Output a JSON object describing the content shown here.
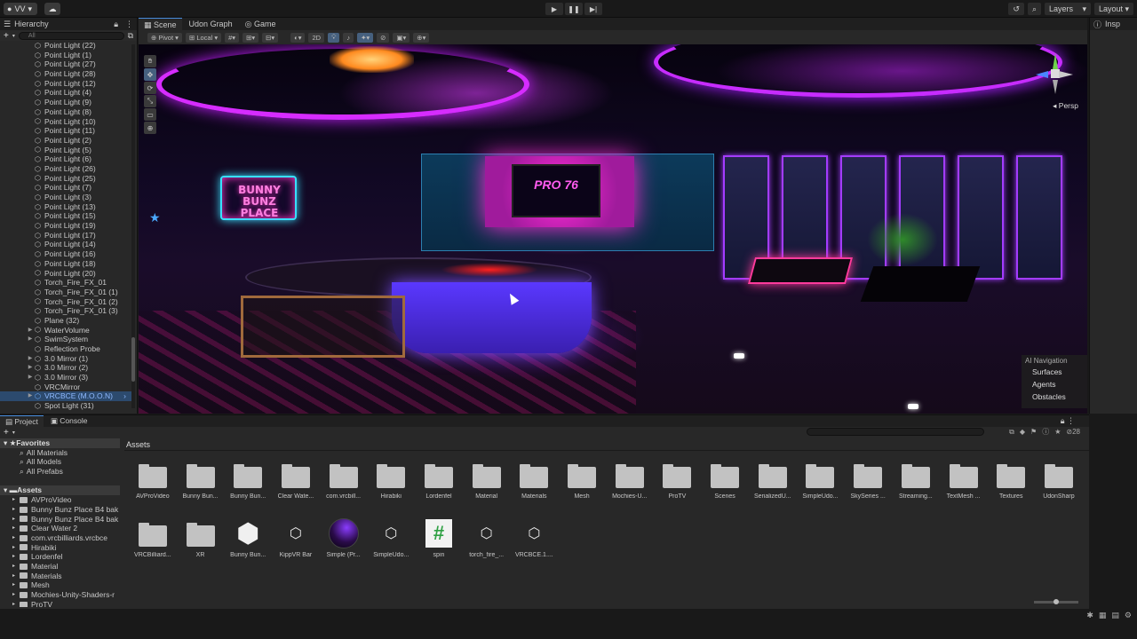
{
  "topbar": {
    "account_label": "VV",
    "right": {
      "layers_label": "Layers",
      "layout_label": "Layout"
    }
  },
  "hierarchy": {
    "tab_label": "Hierarchy",
    "search_placeholder": "All",
    "items": [
      {
        "label": "Point Light (22)",
        "kind": "obj"
      },
      {
        "label": "Point Light (1)",
        "kind": "obj"
      },
      {
        "label": "Point Light (27)",
        "kind": "obj"
      },
      {
        "label": "Point Light (28)",
        "kind": "obj"
      },
      {
        "label": "Point Light (12)",
        "kind": "obj"
      },
      {
        "label": "Point Light (4)",
        "kind": "obj"
      },
      {
        "label": "Point Light (9)",
        "kind": "obj"
      },
      {
        "label": "Point Light (8)",
        "kind": "obj"
      },
      {
        "label": "Point Light (10)",
        "kind": "obj"
      },
      {
        "label": "Point Light (11)",
        "kind": "obj"
      },
      {
        "label": "Point Light (2)",
        "kind": "obj"
      },
      {
        "label": "Point Light (5)",
        "kind": "obj"
      },
      {
        "label": "Point Light (6)",
        "kind": "obj"
      },
      {
        "label": "Point Light (26)",
        "kind": "obj"
      },
      {
        "label": "Point Light (25)",
        "kind": "obj"
      },
      {
        "label": "Point Light (7)",
        "kind": "obj"
      },
      {
        "label": "Point Light (3)",
        "kind": "obj"
      },
      {
        "label": "Point Light (13)",
        "kind": "obj"
      },
      {
        "label": "Point Light (15)",
        "kind": "obj"
      },
      {
        "label": "Point Light (19)",
        "kind": "obj"
      },
      {
        "label": "Point Light (17)",
        "kind": "obj"
      },
      {
        "label": "Point Light (14)",
        "kind": "obj"
      },
      {
        "label": "Point Light (16)",
        "kind": "obj"
      },
      {
        "label": "Point Light (18)",
        "kind": "obj"
      },
      {
        "label": "Point Light (20)",
        "kind": "obj"
      },
      {
        "label": "Torch_Fire_FX_01",
        "kind": "obj"
      },
      {
        "label": "Torch_Fire_FX_01 (1)",
        "kind": "obj"
      },
      {
        "label": "Torch_Fire_FX_01 (2)",
        "kind": "obj"
      },
      {
        "label": "Torch_Fire_FX_01 (3)",
        "kind": "obj"
      },
      {
        "label": "Plane (32)",
        "kind": "obj"
      },
      {
        "label": "WaterVolume",
        "kind": "group"
      },
      {
        "label": "SwimSystem",
        "kind": "group"
      },
      {
        "label": "Reflection Probe",
        "kind": "obj"
      },
      {
        "label": "3.0 Mirror (1)",
        "kind": "group"
      },
      {
        "label": "3.0 Mirror (2)",
        "kind": "group"
      },
      {
        "label": "3.0 Mirror (3)",
        "kind": "group"
      },
      {
        "label": "VRCMirror",
        "kind": "obj"
      },
      {
        "label": "VRCBCE (M.O.O.N)",
        "kind": "selected"
      },
      {
        "label": "Spot Light (31)",
        "kind": "obj"
      }
    ]
  },
  "scene": {
    "tabs": [
      "Scene",
      "Udon Graph",
      "Game"
    ],
    "tools": [
      "Pivot",
      "Local",
      "2D"
    ],
    "sign_text": "BUNNY BUNZ PLACE",
    "tv_text": "PRO 76",
    "persp_label": "Persp",
    "ai_nav": {
      "title": "AI Navigation",
      "items": [
        "Surfaces",
        "Agents",
        "Obstacles"
      ]
    }
  },
  "inspector": {
    "tab_label": "Insp"
  },
  "project": {
    "tabs": [
      "Project",
      "Console"
    ],
    "visible_count": "28",
    "assets_header": "Assets",
    "tree": [
      {
        "label": "Favorites",
        "kind": "hdr"
      },
      {
        "label": "All Materials",
        "kind": "fav"
      },
      {
        "label": "All Models",
        "kind": "fav"
      },
      {
        "label": "All Prefabs",
        "kind": "fav"
      },
      {
        "label": "",
        "kind": "gap"
      },
      {
        "label": "Assets",
        "kind": "hdr"
      },
      {
        "label": "AVProVideo",
        "kind": "folder"
      },
      {
        "label": "Bunny Bunz Place B4 bak",
        "kind": "folder"
      },
      {
        "label": "Bunny Bunz Place B4 bak",
        "kind": "folder"
      },
      {
        "label": "Clear Water 2",
        "kind": "folder"
      },
      {
        "label": "com.vrcbilliards.vrcbce",
        "kind": "folder"
      },
      {
        "label": "Hirabiki",
        "kind": "folder"
      },
      {
        "label": "Lordenfel",
        "kind": "folder"
      },
      {
        "label": "Material",
        "kind": "folder"
      },
      {
        "label": "Materials",
        "kind": "folder"
      },
      {
        "label": "Mesh",
        "kind": "folder"
      },
      {
        "label": "Mochies-Unity-Shaders-r",
        "kind": "folder"
      },
      {
        "label": "ProTV",
        "kind": "folder"
      }
    ],
    "assets": [
      {
        "label": "AVProVideo",
        "type": "folder"
      },
      {
        "label": "Bunny Bun...",
        "type": "folder"
      },
      {
        "label": "Bunny Bun...",
        "type": "folder"
      },
      {
        "label": "Clear Wate...",
        "type": "folder"
      },
      {
        "label": "com.vrcbill...",
        "type": "folder"
      },
      {
        "label": "Hirabiki",
        "type": "folder"
      },
      {
        "label": "Lordenfel",
        "type": "folder"
      },
      {
        "label": "Material",
        "type": "folder"
      },
      {
        "label": "Materials",
        "type": "folder"
      },
      {
        "label": "Mesh",
        "type": "folder"
      },
      {
        "label": "Mochies-U...",
        "type": "folder"
      },
      {
        "label": "ProTV",
        "type": "folder"
      },
      {
        "label": "Scenes",
        "type": "folder"
      },
      {
        "label": "SerializedU...",
        "type": "folder"
      },
      {
        "label": "SimpleUdo...",
        "type": "folder"
      },
      {
        "label": "SkySeries ...",
        "type": "folder"
      },
      {
        "label": "Streaming...",
        "type": "folder"
      },
      {
        "label": "TextMesh ...",
        "type": "folder"
      },
      {
        "label": "Textures",
        "type": "folder"
      },
      {
        "label": "UdonSharp",
        "type": "folder"
      },
      {
        "label": "VRCBilliard...",
        "type": "folder"
      },
      {
        "label": "XR",
        "type": "folder"
      },
      {
        "label": "Bunny Bun...",
        "type": "unity"
      },
      {
        "label": "KippVR Bar",
        "type": "prefab"
      },
      {
        "label": "Simple (Pr...",
        "type": "material"
      },
      {
        "label": "SimpleUdo...",
        "type": "prefab"
      },
      {
        "label": "spin",
        "type": "script"
      },
      {
        "label": "torch_fire_...",
        "type": "prefab"
      },
      {
        "label": "VRCBCE.1....",
        "type": "prefab"
      }
    ]
  }
}
